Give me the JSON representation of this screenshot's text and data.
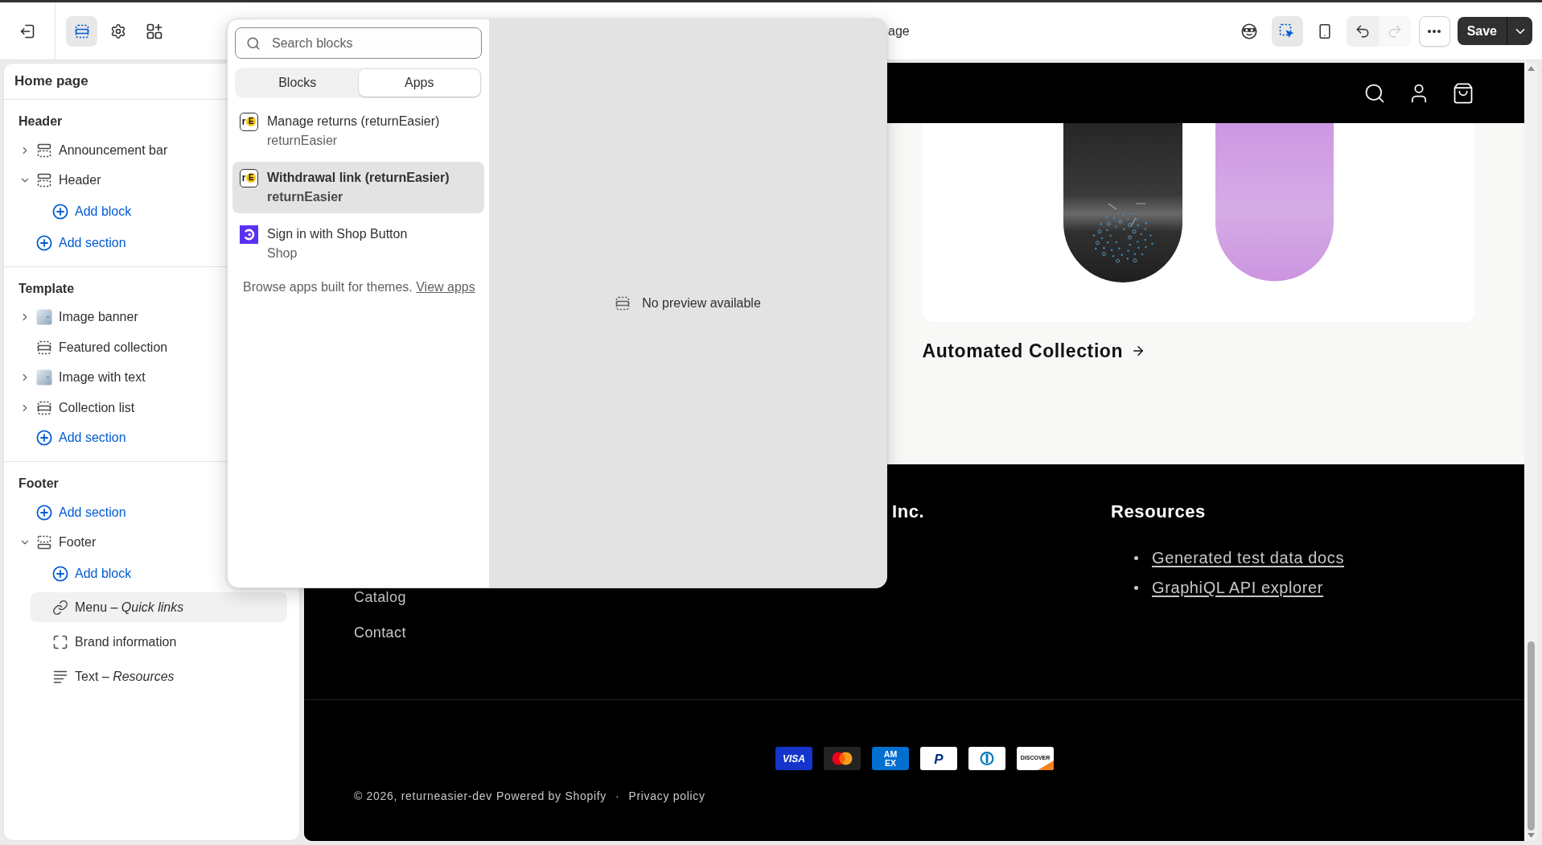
{
  "topbar": {
    "nav_tools": [
      {
        "kind": "sections",
        "selected": true
      },
      {
        "kind": "settings",
        "selected": false
      },
      {
        "kind": "apps",
        "selected": false
      }
    ],
    "title": "age",
    "view_tools": [
      {
        "kind": "customer-view",
        "selected": false
      },
      {
        "kind": "inspector",
        "selected": true
      },
      {
        "kind": "mobile",
        "selected": false
      }
    ],
    "history": [
      {
        "kind": "undo",
        "disabled": false
      },
      {
        "kind": "redo",
        "disabled": true
      }
    ],
    "save_label": "Save"
  },
  "sidebar": {
    "title": "Home page",
    "groups": [
      {
        "heading": "Header",
        "items": [
          {
            "kind": "header-section",
            "label": "Announcement bar",
            "expanded": false,
            "selected": false
          },
          {
            "kind": "header-section",
            "label": "Header",
            "expanded": true,
            "selected": false,
            "children": [
              {
                "kind": "add-block",
                "label": "Add block",
                "selected": false
              }
            ]
          },
          {
            "kind": "add-section",
            "label": "Add section",
            "selected": false
          }
        ]
      },
      {
        "heading": "Template",
        "items": [
          {
            "kind": "image-section",
            "label": "Image banner",
            "expanded": false,
            "selected": false
          },
          {
            "kind": "section",
            "label": "Featured collection",
            "selected": false
          },
          {
            "kind": "image-section",
            "label": "Image with text",
            "expanded": false,
            "selected": false
          },
          {
            "kind": "section",
            "label": "Collection list",
            "expanded": false,
            "selected": false
          },
          {
            "kind": "add-section",
            "label": "Add section",
            "selected": false
          }
        ]
      },
      {
        "heading": "Footer",
        "items": [
          {
            "kind": "add-section",
            "label": "Add section",
            "selected": false
          },
          {
            "kind": "footer-section",
            "label": "Footer",
            "expanded": true,
            "selected": false,
            "children": [
              {
                "kind": "add-block",
                "label": "Add block",
                "selected": false
              },
              {
                "kind": "link-block",
                "label": "Menu *– Quick links*",
                "selected": true
              },
              {
                "kind": "brand-block",
                "label": "Brand information",
                "selected": false
              },
              {
                "kind": "text-block",
                "label": "Text *– Resources*",
                "selected": false
              }
            ]
          }
        ]
      }
    ]
  },
  "block_picker": {
    "search": {
      "placeholder": "Search blocks"
    },
    "tabs": [
      {
        "label": "Blocks",
        "selected": false
      },
      {
        "label": "Apps",
        "selected": true
      }
    ],
    "apps": [
      {
        "kind": "returneasier",
        "logo": {
          "letter": "r",
          "badge": "E"
        },
        "title": "Manage returns (returnEasier)",
        "app": "returnEasier",
        "selected": false
      },
      {
        "kind": "returneasier",
        "logo": {
          "letter": "r",
          "badge": "E"
        },
        "title": "Withdrawal link (returnEasier)",
        "app": "returnEasier",
        "selected": true
      },
      {
        "kind": "shop",
        "title": "Sign in with Shop Button",
        "app": "Shop",
        "selected": false
      }
    ],
    "note": "Browse apps built for themes.",
    "note_link": "View apps",
    "preview_message": "No preview available"
  },
  "storefront": {
    "collection_title": "Automated Collection",
    "footer": {
      "columns": [
        {
          "kind": "menu",
          "links": [
            "Catalog",
            "Contact"
          ]
        },
        {
          "kind": "heading",
          "heading": "Inc."
        },
        {
          "kind": "bullets",
          "heading": "Resources",
          "links": [
            "Generated test data docs",
            "GraphiQL API explorer"
          ]
        }
      ],
      "payment_methods": [
        {
          "kind": "visa",
          "lines": [
            "VISA"
          ]
        },
        {
          "kind": "mastercard"
        },
        {
          "kind": "amex",
          "lines": [
            "AM",
            "EX"
          ]
        },
        {
          "kind": "paypal",
          "lines": [
            "P"
          ]
        },
        {
          "kind": "diners"
        },
        {
          "kind": "discover",
          "lines": [
            "DISCOVER"
          ]
        }
      ],
      "copyright": "© 2026, returneasier-dev",
      "powered_by": "Powered by Shopify",
      "separator": "·",
      "policies": [
        "Privacy policy"
      ]
    }
  }
}
